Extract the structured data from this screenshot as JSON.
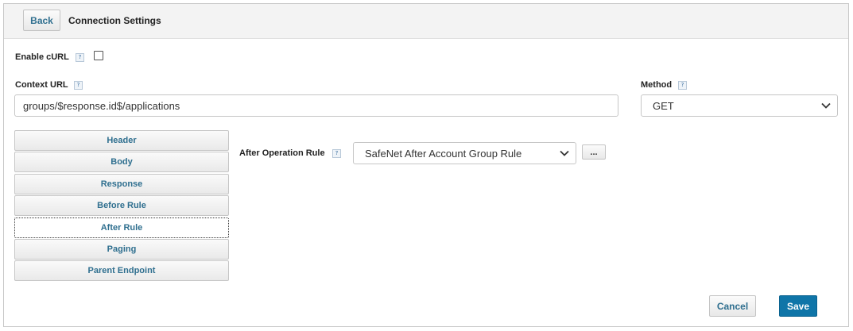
{
  "header": {
    "back_label": "Back",
    "title": "Connection Settings"
  },
  "enable_curl": {
    "label": "Enable cURL",
    "help": "?",
    "checked": false
  },
  "context_url": {
    "label": "Context URL",
    "help": "?",
    "value": "groups/$response.id$/applications"
  },
  "method": {
    "label": "Method",
    "help": "?",
    "value": "GET"
  },
  "tabs": [
    {
      "label": "Header"
    },
    {
      "label": "Body"
    },
    {
      "label": "Response"
    },
    {
      "label": "Before Rule"
    },
    {
      "label": "After Rule"
    },
    {
      "label": "Paging"
    },
    {
      "label": "Parent Endpoint"
    }
  ],
  "active_tab": "After Rule",
  "after_operation_rule": {
    "label": "After Operation Rule",
    "help": "?",
    "value": "SafeNet After Account Group Rule",
    "more_label": "..."
  },
  "footer": {
    "cancel_label": "Cancel",
    "save_label": "Save"
  },
  "icons": {
    "help": "help-icon",
    "dropdown": "chevron-down-icon"
  }
}
